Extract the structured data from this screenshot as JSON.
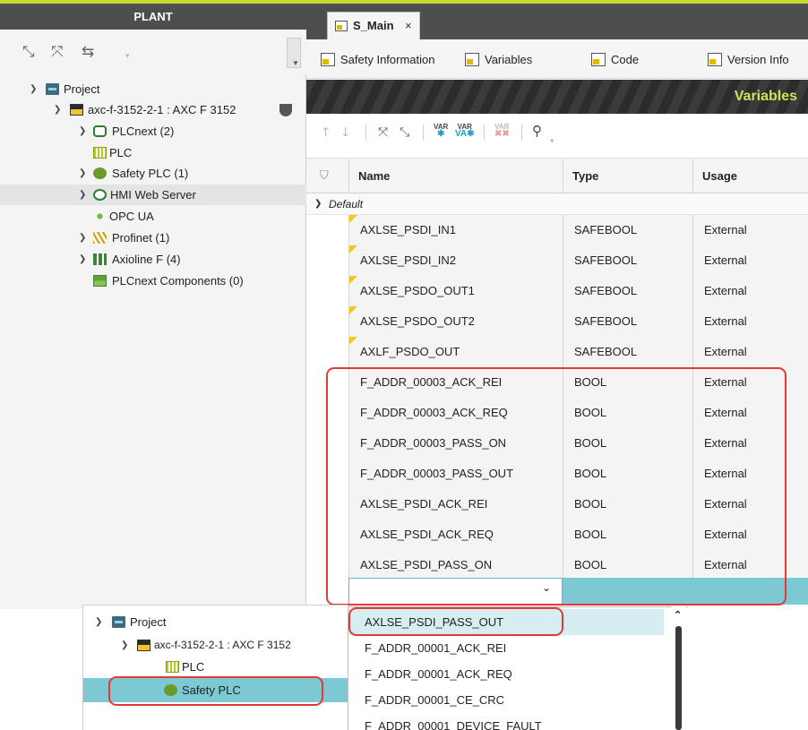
{
  "plant": {
    "header": "PLANT",
    "tree": [
      {
        "label": "Project"
      },
      {
        "label": "axc-f-3152-2-1 : AXC F 3152"
      },
      {
        "label": "PLCnext (2)"
      },
      {
        "label": "PLC"
      },
      {
        "label": "Safety PLC (1)"
      },
      {
        "label": "HMI Web Server"
      },
      {
        "label": "OPC UA"
      },
      {
        "label": "Profinet (1)"
      },
      {
        "label": "Axioline F (4)"
      },
      {
        "label": "PLCnext Components (0)"
      }
    ]
  },
  "editor": {
    "tab_label": "S_Main",
    "tab_close": "×",
    "subtabs": [
      "Safety Information",
      "Variables",
      "Code",
      "Version Info"
    ],
    "banner_title": "Variables",
    "columns": {
      "name": "Name",
      "type": "Type",
      "usage": "Usage"
    },
    "group": "Default",
    "rows": [
      {
        "name": "AXLSE_PSDI_IN1",
        "type": "SAFEBOOL",
        "usage": "External"
      },
      {
        "name": "AXLSE_PSDI_IN2",
        "type": "SAFEBOOL",
        "usage": "External"
      },
      {
        "name": "AXLSE_PSDO_OUT1",
        "type": "SAFEBOOL",
        "usage": "External"
      },
      {
        "name": "AXLSE_PSDO_OUT2",
        "type": "SAFEBOOL",
        "usage": "External"
      },
      {
        "name": "AXLF_PSDO_OUT",
        "type": "SAFEBOOL",
        "usage": "External"
      },
      {
        "name": "F_ADDR_00003_ACK_REI",
        "type": "BOOL",
        "usage": "External"
      },
      {
        "name": "F_ADDR_00003_ACK_REQ",
        "type": "BOOL",
        "usage": "External"
      },
      {
        "name": "F_ADDR_00003_PASS_ON",
        "type": "BOOL",
        "usage": "External"
      },
      {
        "name": "F_ADDR_00003_PASS_OUT",
        "type": "BOOL",
        "usage": "External"
      },
      {
        "name": "AXLSE_PSDI_ACK_REI",
        "type": "BOOL",
        "usage": "External"
      },
      {
        "name": "AXLSE_PSDI_ACK_REQ",
        "type": "BOOL",
        "usage": "External"
      },
      {
        "name": "AXLSE_PSDI_PASS_ON",
        "type": "BOOL",
        "usage": "External"
      }
    ],
    "new_row_value": ""
  },
  "overlay_tree": [
    {
      "label": "Project"
    },
    {
      "label": "axc-f-3152-2-1 : AXC F 3152"
    },
    {
      "label": "PLC"
    },
    {
      "label": "Safety PLC"
    }
  ],
  "dropdown": {
    "items": [
      "AXLSE_PSDI_PASS_OUT",
      "F_ADDR_00001_ACK_REI",
      "F_ADDR_00001_ACK_REQ",
      "F_ADDR_00001_CE_CRC",
      "F_ADDR_00001_DEVICE_FAULT"
    ],
    "selected": "AXLSE_PSDI_PASS_OUT"
  },
  "colors": {
    "accent_lime": "#c4d82e",
    "banner_text": "#d4e157",
    "selection_teal": "#7cc9d3",
    "highlight_red": "#e53935",
    "safety_flag": "#f3c623"
  }
}
